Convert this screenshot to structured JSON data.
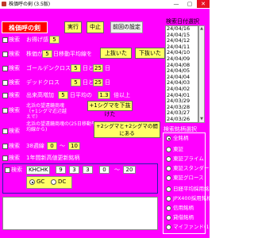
{
  "window": {
    "title": "株価呼の剣 (3.5版)",
    "minimize": "—",
    "maximize": "▢",
    "close": "✕"
  },
  "toolbar": {
    "main_label": "株価呼の剣",
    "run_label": "実行",
    "stop_label": "中止",
    "prev_settings_label": "前回の設定"
  },
  "check_label": "検索",
  "dates": {
    "header": "検索日付選択",
    "items": [
      "24/04/16",
      "24/04/15",
      "24/04/12",
      "24/04/11",
      "24/04/10",
      "24/04/09",
      "24/04/08",
      "24/04/05",
      "24/04/04",
      "24/04/03",
      "24/04/02",
      "24/04/01",
      "24/03/29",
      "24/03/28",
      "24/03/27",
      "24/03/26",
      "24/03/25",
      "24/03/22",
      "24/03/21",
      "24/03/19",
      "24/03/18",
      "24/03/15",
      "24/03/14",
      "24/03/13"
    ],
    "selected": "24/03/13"
  },
  "rows": {
    "otoku": {
      "label": "お得げ感",
      "value": "5"
    },
    "ma": {
      "label_a": "株価が",
      "value": "5",
      "label_b": "日移動平均線を",
      "btn_up": "上抜いた",
      "btn_down": "下抜いた"
    },
    "gc": {
      "label": "ゴールデンクロス",
      "v1": "5",
      "label_mid": "日と",
      "v2": "25",
      "label_end": "日"
    },
    "dc": {
      "label": "デッドクロス",
      "v1": "5",
      "label_mid": "日と",
      "v2": "25",
      "label_end": "日"
    },
    "vol": {
      "label": "出来高増加",
      "v1": "5",
      "label_mid": "日平均の",
      "v2": "1.3",
      "label_end": "倍以上"
    },
    "bollinger1": {
      "text": "北浜の望遠鏡商魂（+1シグマ近辺越えで）",
      "btn": "+1シグマを下抜けた"
    },
    "bollinger2": {
      "text": "北浜の望遠鏡商魂の(25日移動平均線から)",
      "btn": "+2シグマと+2シグマの間にある"
    },
    "days38": {
      "label": "38週線",
      "v1": "0",
      "label_mid": "〜",
      "v2": "10"
    },
    "ytd": {
      "label": "1年間新高値更新銘柄"
    },
    "khchk": {
      "label": "KHCHK",
      "v1": "9",
      "v2": "3",
      "v3": "3",
      "v4": "0",
      "sep": "〜",
      "v5": "20",
      "opt_gc": "GC",
      "opt_dc": "DC"
    }
  },
  "market": {
    "header": "検索銘柄選択",
    "options": [
      "全銘柄",
      "東証",
      "東証プライム",
      "東証スタンダード",
      "東証グロース",
      "日経平均採用銘柄",
      "JPX400採用銘柄",
      "信用銘柄",
      "貸借銘柄",
      "マイファンド(1〜100)"
    ],
    "selected": "全銘柄"
  },
  "colors": {
    "background": "#ff00ff",
    "accent_red": "#ff0000",
    "button_yellow": "#ffff66",
    "selection": "#3b7bd6"
  }
}
